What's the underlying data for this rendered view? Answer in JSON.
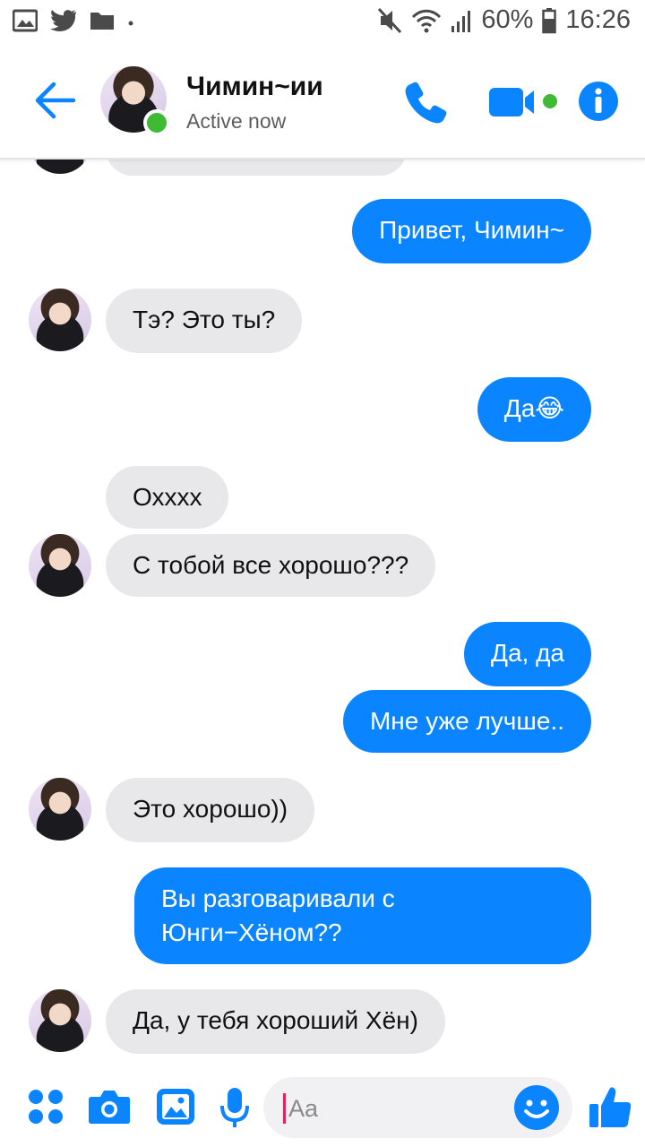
{
  "status_bar": {
    "battery": "60%",
    "time": "16:26"
  },
  "header": {
    "contact_name": "Чимин~ии",
    "presence": "Active now"
  },
  "messages": [
    {
      "side": "in",
      "text": "Тэ? Это ты?"
    },
    {
      "side": "out",
      "text": "Привет, Чимин~"
    },
    {
      "side": "out",
      "text": "Да😂"
    },
    {
      "side": "in",
      "text": "Охххх"
    },
    {
      "side": "in",
      "text": "С тобой все хорошо???"
    },
    {
      "side": "out",
      "text": "Да, да"
    },
    {
      "side": "out",
      "text": "Мне уже лучше.."
    },
    {
      "side": "in",
      "text": "Это хорошо))"
    },
    {
      "side": "out",
      "text_line1": "Вы разговаривали с",
      "text_line2": "Юнги−Хёном??"
    },
    {
      "side": "in",
      "text": "Да, у тебя хороший Хён)"
    }
  ],
  "composer": {
    "placeholder": "Aa"
  },
  "colors": {
    "accent": "#0a84ff",
    "incoming_bubble": "#e8e8eb",
    "online": "#3fba35"
  }
}
